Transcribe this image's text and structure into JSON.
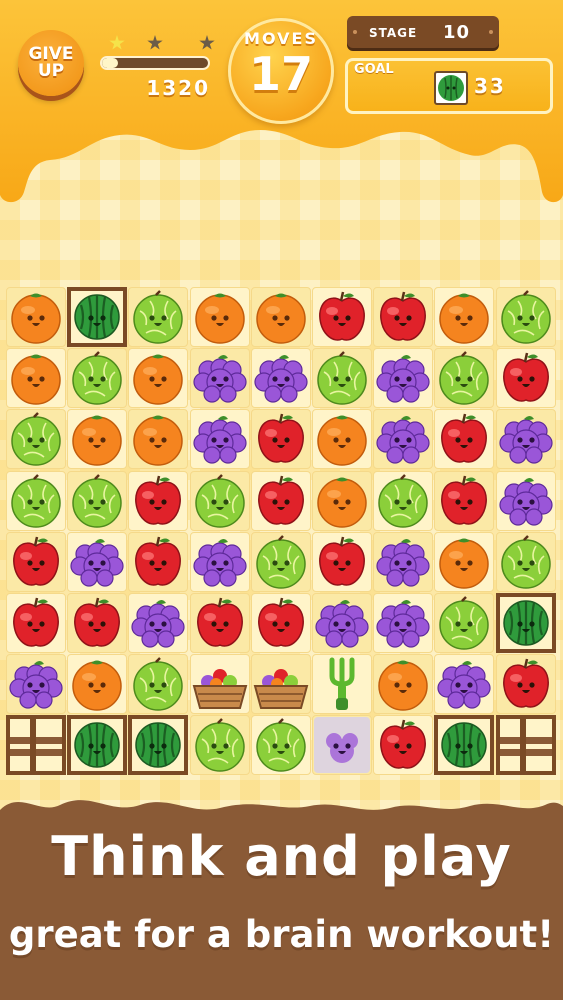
{
  "hud": {
    "give_up_label": "GIVE\nUP",
    "score": "1320",
    "score_progress": 0.15,
    "stars_earned": 1,
    "stars_total": 3,
    "moves_label": "MOVES",
    "moves_value": "17",
    "stage_label": "STAGE",
    "stage_value": "10",
    "goal_label": "GOAL",
    "goal_target": "watermelon",
    "goal_count": "33"
  },
  "board": {
    "columns": 9,
    "rows": 8,
    "grid": [
      [
        "orange",
        "watermelon-crate",
        "melon",
        "orange",
        "orange",
        "apple",
        "apple",
        "orange",
        "melon"
      ],
      [
        "orange",
        "melon",
        "orange",
        "grape",
        "grape",
        "melon",
        "grape",
        "melon",
        "apple"
      ],
      [
        "melon",
        "orange",
        "orange",
        "grape",
        "apple",
        "orange",
        "grape",
        "apple",
        "grape"
      ],
      [
        "melon",
        "melon",
        "apple",
        "melon",
        "apple",
        "orange",
        "melon",
        "apple",
        "grape"
      ],
      [
        "apple",
        "grape",
        "apple",
        "grape",
        "melon",
        "apple",
        "grape",
        "orange",
        "melon"
      ],
      [
        "apple",
        "apple",
        "grape",
        "apple",
        "apple",
        "grape",
        "grape",
        "melon",
        "watermelon-crate"
      ],
      [
        "grape",
        "orange",
        "melon",
        "basket",
        "basket",
        "fork",
        "orange",
        "grape",
        "apple"
      ],
      [
        "crate",
        "watermelon-crate",
        "watermelon-crate",
        "melon",
        "melon",
        "grape-jelly",
        "apple",
        "watermelon-crate",
        "crate"
      ]
    ]
  },
  "colors": {
    "orange": "#f5841f",
    "apple": "#e0222a",
    "melon": "#8bcf3a",
    "grape": "#9a56d8",
    "watermelon": "#2f9b3c",
    "wood": "#7a4a25",
    "honey": "#fbb62a"
  },
  "tagline": {
    "line1": "Think and play",
    "line2": "great for a brain workout!"
  }
}
